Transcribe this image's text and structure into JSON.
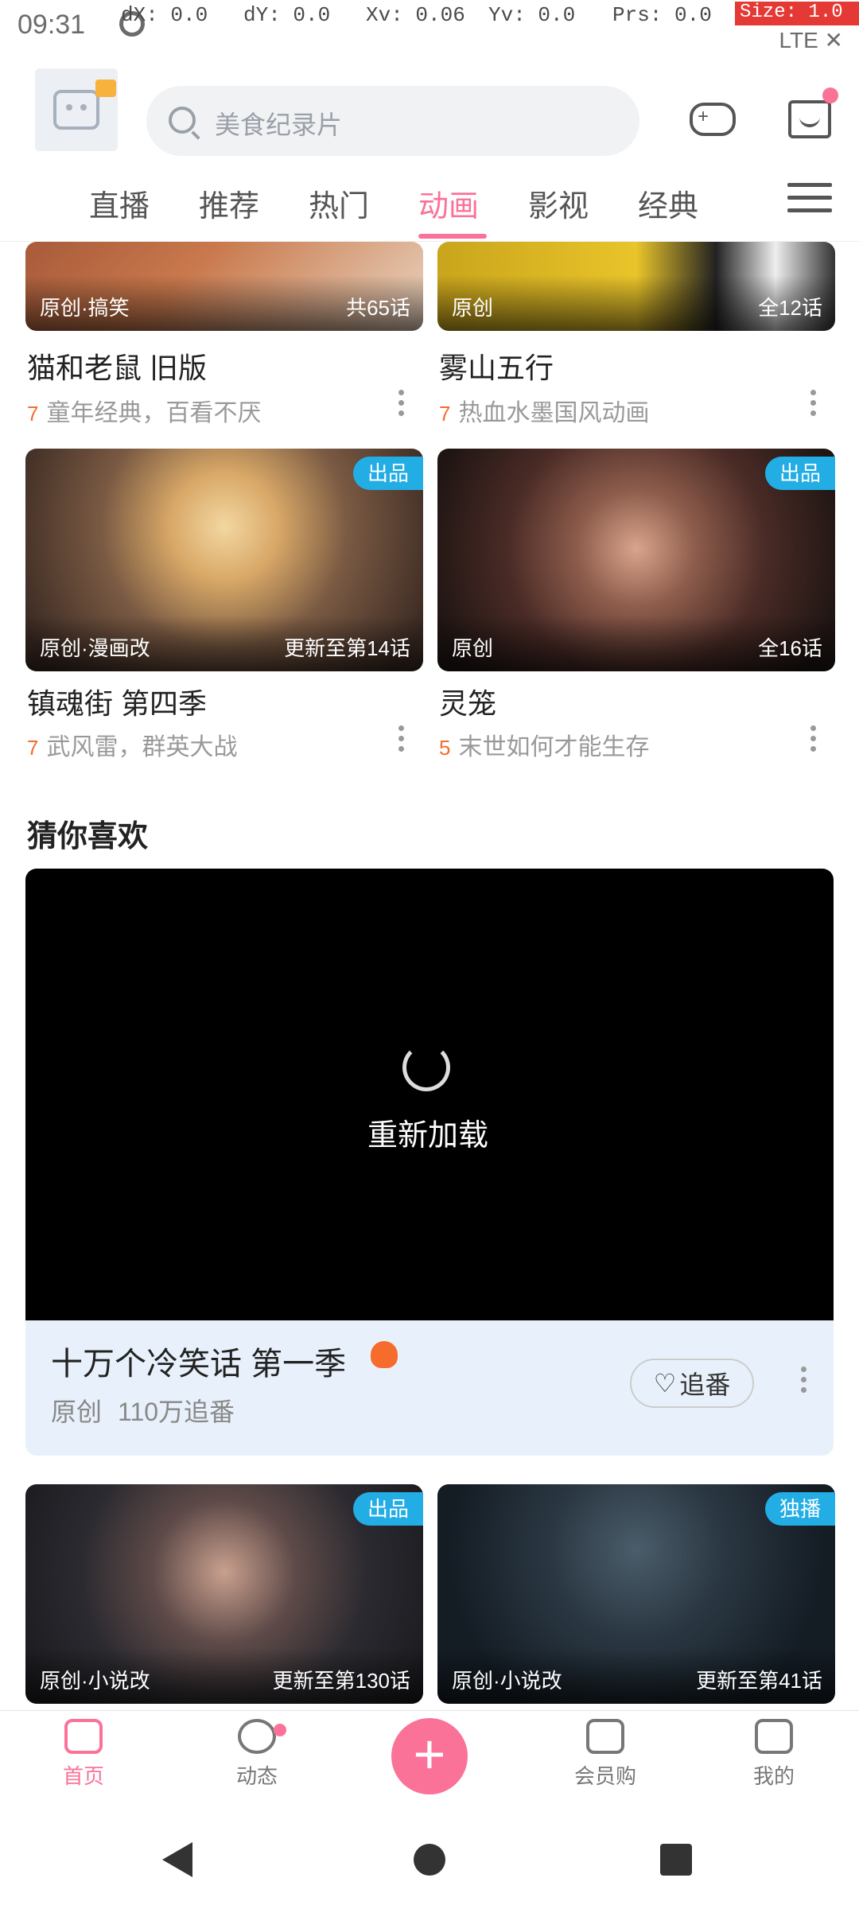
{
  "status_bar": {
    "time": "09:31",
    "debug": {
      "dx": "dX: 0.0",
      "dy": "dY: 0.0",
      "xv": "Xv: 0.06",
      "yv": "Yv: 0.0",
      "prs": "Prs: 0.0",
      "size": "Size: 1.0"
    },
    "system_icons": "LTE ✕"
  },
  "topbar": {
    "search_placeholder": "美食纪录片"
  },
  "tabs": [
    {
      "label": "直播"
    },
    {
      "label": "推荐"
    },
    {
      "label": "热门"
    },
    {
      "label": "动画",
      "active": true
    },
    {
      "label": "影视"
    },
    {
      "label": "经典"
    }
  ],
  "colors": {
    "accent": "#fb7299",
    "badge": "#23ade5",
    "tag": "#f56c2d"
  },
  "cards_row1": [
    {
      "thumb_left": "原创·搞笑",
      "thumb_right": "共65话",
      "title": "猫和老鼠 旧版",
      "tag": "7",
      "subtitle": "童年经典，百看不厌"
    },
    {
      "thumb_left": "原创",
      "thumb_right": "全12话",
      "title": "雾山五行",
      "tag": "7",
      "subtitle": "热血水墨国风动画"
    }
  ],
  "cards_row2": [
    {
      "badge": "出品",
      "thumb_left": "原创·漫画改",
      "thumb_right": "更新至第14话",
      "title": "镇魂街 第四季",
      "tag": "7",
      "subtitle": "武风雷，群英大战"
    },
    {
      "badge": "出品",
      "thumb_left": "原创",
      "thumb_right": "全16话",
      "title": "灵笼",
      "tag": "5",
      "subtitle": "末世如何才能生存"
    }
  ],
  "section": {
    "title": "猜你喜欢"
  },
  "player": {
    "reload_label": "重新加载",
    "promo_title": "十万个冷笑话 第一季",
    "promo_tag": "原创",
    "promo_follow": "110万追番",
    "follow_label": "追番"
  },
  "cards_row3": [
    {
      "badge": "出品",
      "thumb_left": "原创·小说改",
      "thumb_right": "更新至第130话"
    },
    {
      "badge": "独播",
      "thumb_left": "原创·小说改",
      "thumb_right": "更新至第41话"
    }
  ],
  "bottom_nav": [
    {
      "label": "首页",
      "active": true
    },
    {
      "label": "动态"
    },
    {
      "label": "会员购"
    },
    {
      "label": "我的"
    }
  ]
}
